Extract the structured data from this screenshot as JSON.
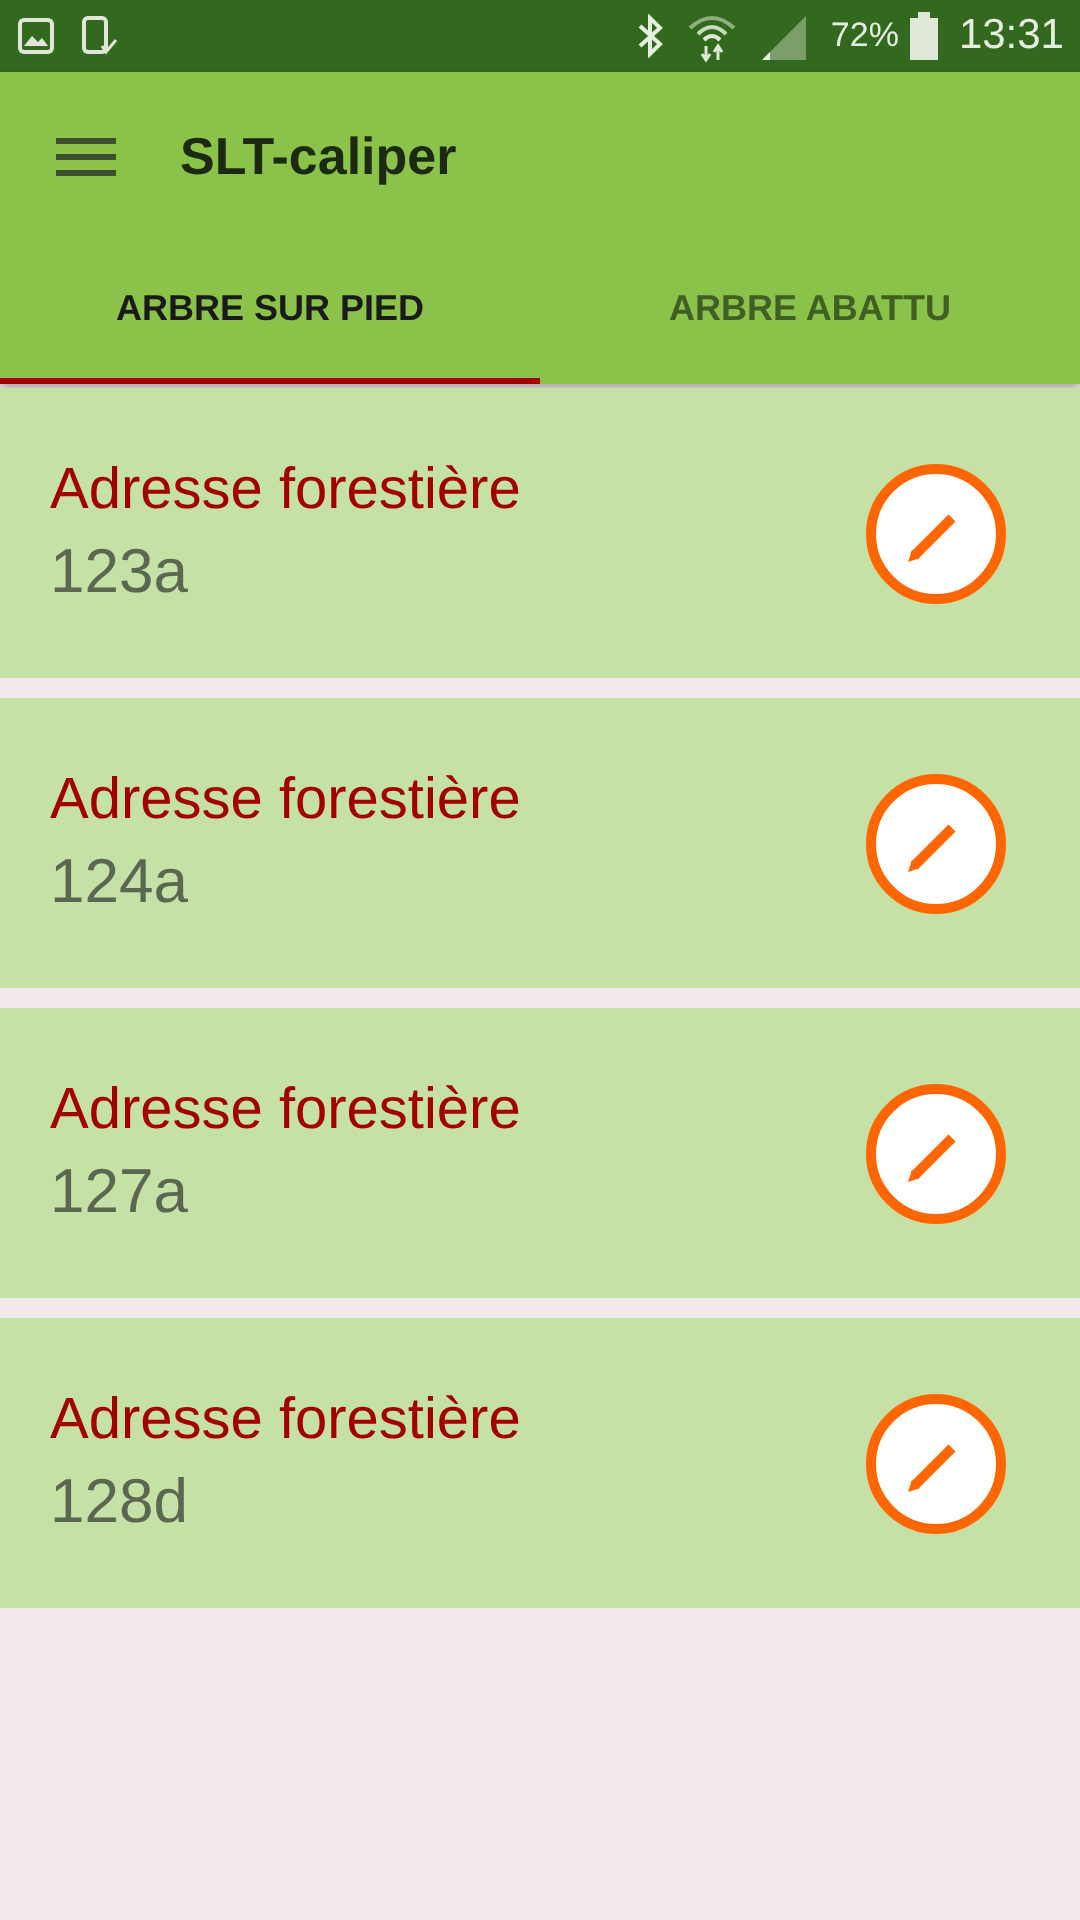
{
  "status_bar": {
    "battery": "72%",
    "time": "13:31"
  },
  "app_bar": {
    "title": "SLT-caliper"
  },
  "tabs": [
    {
      "label": "ARBRE SUR PIED",
      "selected": true
    },
    {
      "label": "ARBRE ABATTU",
      "selected": false
    }
  ],
  "items": [
    {
      "title": "Adresse forestière",
      "code": "123a"
    },
    {
      "title": "Adresse forestière",
      "code": "124a"
    },
    {
      "title": "Adresse forestière",
      "code": "127a"
    },
    {
      "title": "Adresse forestière",
      "code": "128d"
    }
  ]
}
